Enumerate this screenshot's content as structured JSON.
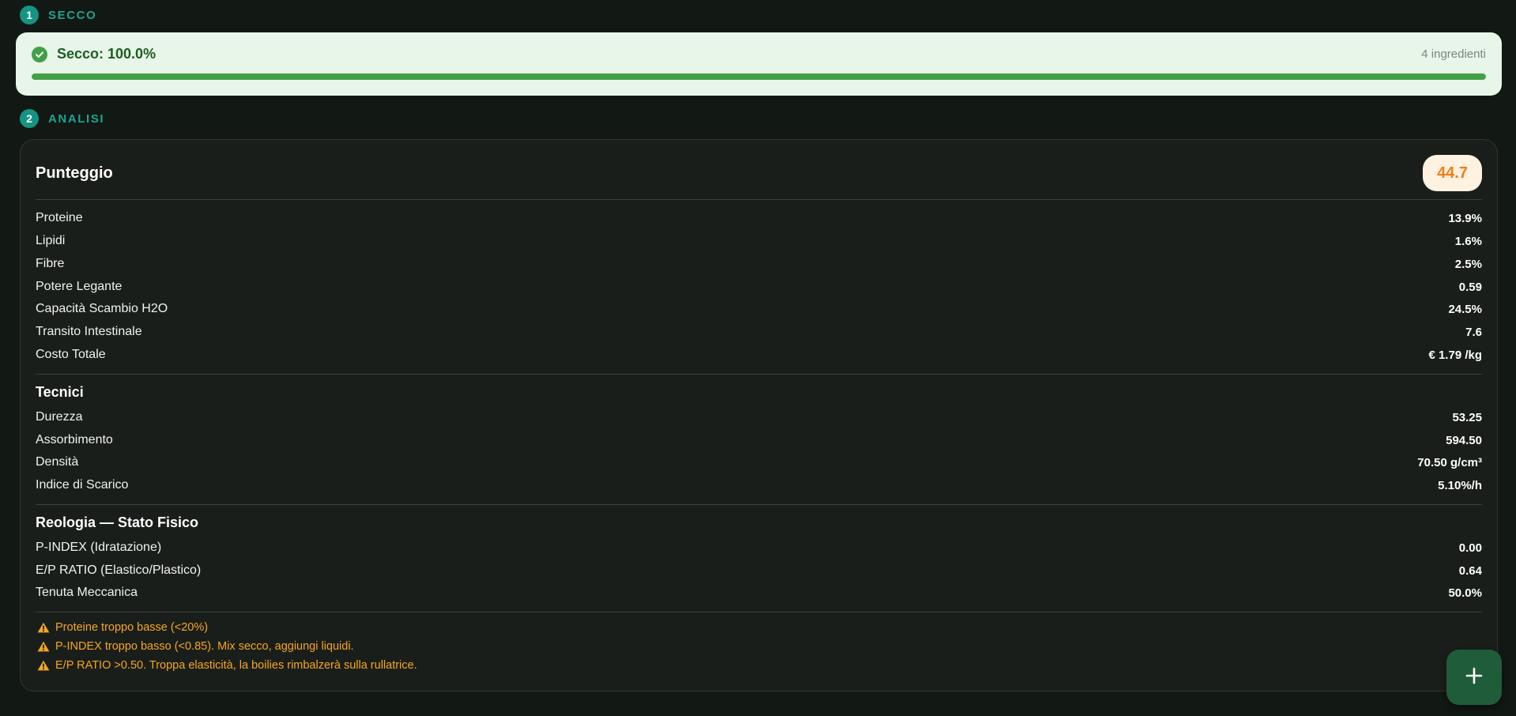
{
  "step1": {
    "number": "1",
    "title": "SECCO"
  },
  "secco": {
    "label": "Secco: 100.0%",
    "count": "4 ingredienti",
    "progress": 1.0
  },
  "step2": {
    "number": "2",
    "title": "ANALISI"
  },
  "score": {
    "title": "Punteggio",
    "value": "44.7"
  },
  "metrics": [
    {
      "label": "Proteine",
      "value": "13.9%"
    },
    {
      "label": "Lipidi",
      "value": "1.6%"
    },
    {
      "label": "Fibre",
      "value": "2.5%"
    },
    {
      "label": "Potere Legante",
      "value": "0.59"
    },
    {
      "label": "Capacità Scambio H2O",
      "value": "24.5%"
    },
    {
      "label": "Transito Intestinale",
      "value": "7.6"
    },
    {
      "label": "Costo Totale",
      "value": "€ 1.79 /kg"
    }
  ],
  "tecnici": {
    "title": "Tecnici",
    "items": [
      {
        "label": "Durezza",
        "value": "53.25"
      },
      {
        "label": "Assorbimento",
        "value": "594.50"
      },
      {
        "label": "Densità",
        "value": "70.50 g/cm³"
      },
      {
        "label": "Indice di Scarico",
        "value": "5.10%/h"
      }
    ]
  },
  "reologia": {
    "title": "Reologia — Stato Fisico",
    "items": [
      {
        "label": "P-INDEX (Idratazione)",
        "value": "0.00"
      },
      {
        "label": "E/P RATIO (Elastico/Plastico)",
        "value": "0.64"
      },
      {
        "label": "Tenuta Meccanica",
        "value": "50.0%"
      }
    ]
  },
  "warnings": [
    "Proteine troppo basse (<20%)",
    "P-INDEX troppo basso (<0.85). Mix secco, aggiungi liquidi.",
    "E/P RATIO >0.50. Troppa elasticità, la boilies rimbalzerà sulla rullatrice."
  ],
  "colors": {
    "accent": "#159383",
    "success": "#43a047",
    "warning": "#f5a623",
    "score": "#f07d1a"
  },
  "icons": {
    "secco_status": "check-circle-icon",
    "warning": "warning-icon",
    "fab": "plus-icon"
  }
}
